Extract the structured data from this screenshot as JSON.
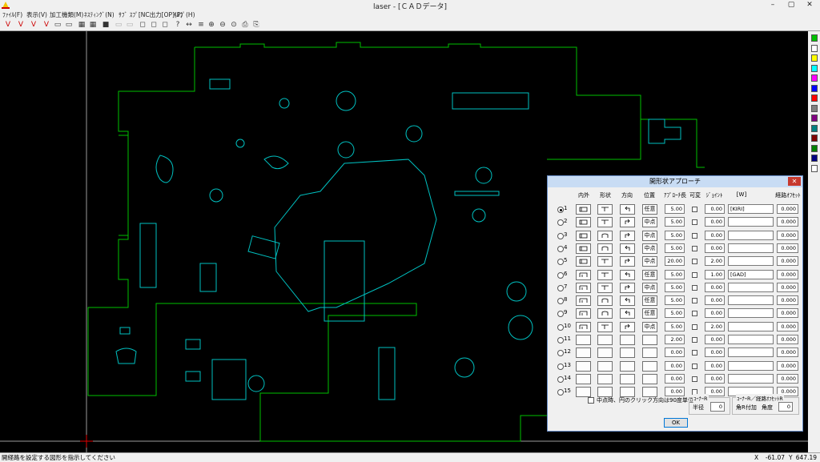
{
  "window": {
    "title": "laser - [ＣＡＤデータ]",
    "min": "–",
    "max": "▢",
    "close": "✕"
  },
  "menu": [
    "ﾌｧｲﾙ(F)",
    "表示(V)",
    "加工機類(M)",
    "ﾈｽﾃｨﾝｸﾞ(N)",
    "ｻﾌﾞ ｽﾌﾟ[NC出力[OP](P)",
    "ﾍﾙﾌﾟ(H)"
  ],
  "toolbar": {
    "icons": [
      "v-icon",
      "v-icon",
      "v-icon",
      "v-icon",
      "copy-icon",
      "paste-icon",
      "grid-icon",
      "grid-icon",
      "save-icon",
      "disabled-icon",
      "disabled-icon",
      "shape-icon",
      "shape-icon",
      "shape-icon",
      "help-icon",
      "arrow-icon",
      "pierce-icon",
      "zoom-in-icon",
      "zoom-out-icon",
      "zoom-fit-icon",
      "print-icon",
      "print-preview-icon"
    ],
    "glyphs": [
      "V",
      "V",
      "V",
      "V",
      "▭",
      "▭",
      "▦",
      "▦",
      "■",
      "▭",
      "▭",
      "◻",
      "◻",
      "◻",
      "?",
      "↔",
      "≡",
      "⊕",
      "⊖",
      "⊙",
      "⎙",
      "⎘"
    ]
  },
  "palette": [
    "#00c000",
    "#ffffff",
    "#ffff00",
    "#00ffff",
    "#ff00ff",
    "#0000ff",
    "#ff0000",
    "#808080",
    "#800080",
    "#008080",
    "#800000",
    "#008000",
    "#000080",
    "#ffffff"
  ],
  "status": {
    "hint": "開経路を設定する図形を指示してください",
    "x_label": "X",
    "x_value": "-61.07",
    "y_label": "Y",
    "y_value": "647.19"
  },
  "dialog": {
    "title": "開形状アプローチ",
    "close": "✕",
    "headers": [
      "内外",
      "形状",
      "方向",
      "位置",
      "ｱﾌﾟﾛｰﾁ長",
      "可変",
      "ｼﾞｮｲﾝﾄ",
      "[W]",
      "経路ｵﾌｾｯﾄ"
    ],
    "rows": [
      {
        "n": "1",
        "pos": "任意",
        "len": "5.00",
        "joint": "0.00",
        "w": "[KIRI]",
        "off": "0.000"
      },
      {
        "n": "2",
        "pos": "中点",
        "len": "5.00",
        "joint": "0.00",
        "w": "",
        "off": "0.000"
      },
      {
        "n": "3",
        "pos": "中点",
        "len": "5.00",
        "joint": "0.00",
        "w": "",
        "off": "0.000"
      },
      {
        "n": "4",
        "pos": "中点",
        "len": "5.00",
        "joint": "0.00",
        "w": "",
        "off": "0.000"
      },
      {
        "n": "5",
        "pos": "中点",
        "len": "20.00",
        "joint": "2.00",
        "w": "",
        "off": "0.000"
      },
      {
        "n": "6",
        "pos": "任意",
        "len": "5.00",
        "joint": "1.00",
        "w": "[GAD]",
        "off": "0.000"
      },
      {
        "n": "7",
        "pos": "中点",
        "len": "5.00",
        "joint": "0.00",
        "w": "",
        "off": "0.000"
      },
      {
        "n": "8",
        "pos": "任意",
        "len": "5.00",
        "joint": "0.00",
        "w": "",
        "off": "0.000"
      },
      {
        "n": "9",
        "pos": "任意",
        "len": "5.00",
        "joint": "0.00",
        "w": "",
        "off": "0.000"
      },
      {
        "n": "10",
        "pos": "中点",
        "len": "5.00",
        "joint": "2.00",
        "w": "",
        "off": "0.000"
      },
      {
        "n": "11",
        "pos": "",
        "len": "2.00",
        "joint": "0.00",
        "w": "",
        "off": "0.000"
      },
      {
        "n": "12",
        "pos": "",
        "len": "0.00",
        "joint": "0.00",
        "w": "",
        "off": "0.000"
      },
      {
        "n": "13",
        "pos": "",
        "len": "0.00",
        "joint": "0.00",
        "w": "",
        "off": "0.000"
      },
      {
        "n": "14",
        "pos": "",
        "len": "0.00",
        "joint": "0.00",
        "w": "",
        "off": "0.000"
      },
      {
        "n": "15",
        "pos": "",
        "len": "0.00",
        "joint": "0.00",
        "w": "",
        "off": "0.000"
      }
    ],
    "checkbox_label": "中点時、円のクリック方向は90度単位",
    "corner_r_group": "ｺｰﾅｰR",
    "radius_label": "半径",
    "radius_value": "0",
    "corner_offset_group": "ｺｰﾅｰR／経路ｵﾌｾｯﾄR",
    "angle_add_label": "角R付加",
    "angle_label": "角度",
    "angle_value": "0",
    "ok": "OK"
  }
}
